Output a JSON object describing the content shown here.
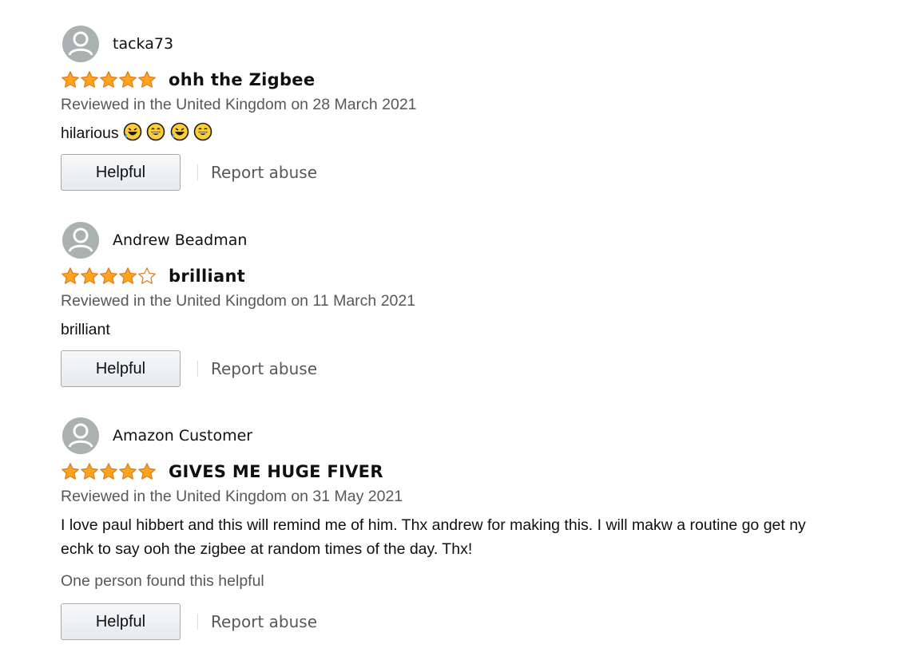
{
  "colors": {
    "star": "#ffa41c",
    "star_stroke": "#de7921",
    "muted": "#565959",
    "text": "#0f1111"
  },
  "reviews": [
    {
      "name": "tacka73",
      "rating": 5,
      "title": "ohh the Zigbee",
      "date": "Reviewed in the United Kingdom on 28 March 2021",
      "body": "hilarious",
      "emojis": [
        "rofl-emoji",
        "grin-sweat-emoji",
        "rofl-emoji",
        "grin-sweat-emoji"
      ],
      "helpful_label": "Helpful",
      "report_label": "Report abuse"
    },
    {
      "name": "Andrew Beadman",
      "rating": 4,
      "title": "brilliant",
      "date": "Reviewed in the United Kingdom on 11 March 2021",
      "body": "brilliant",
      "helpful_label": "Helpful",
      "report_label": "Report abuse"
    },
    {
      "name": "Amazon Customer",
      "rating": 5,
      "title": "GIVES ME HUGE FIVER",
      "date": "Reviewed in the United Kingdom on 31 May 2021",
      "body_lines": [
        "I love paul hibbert and this will remind me of him. Thx andrew for making this. I will makw a routine go get ny",
        "echk to say ooh the zigbee at random times of the day. Thx!"
      ],
      "helpful_count": "One person found this helpful",
      "helpful_label": "Helpful",
      "report_label": "Report abuse"
    }
  ]
}
